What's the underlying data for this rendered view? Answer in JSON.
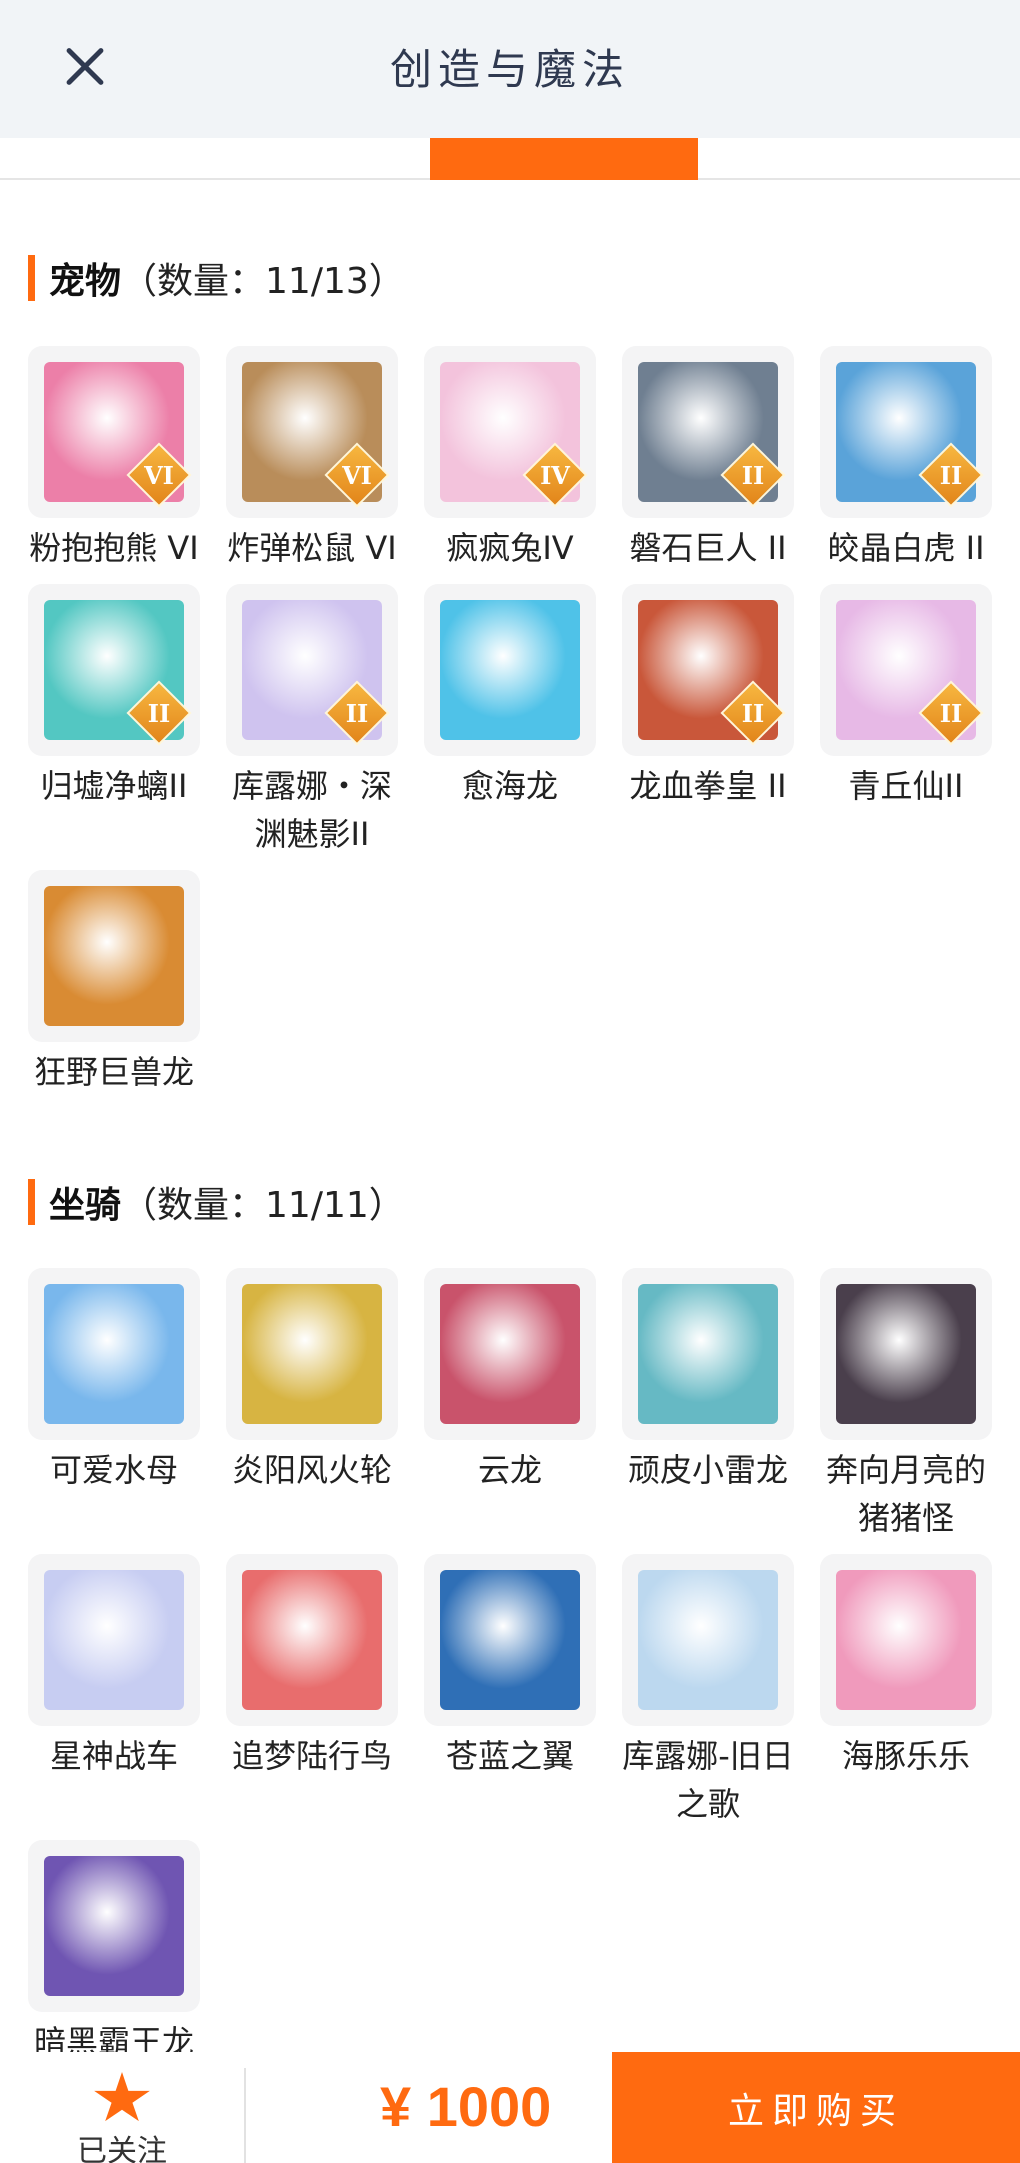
{
  "header": {
    "title": "创造与魔法",
    "close_icon": "close-icon"
  },
  "pets": {
    "title": "宠物",
    "count": "（数量：11/13）",
    "items": [
      {
        "name": "粉抱抱熊 VI",
        "badge": "VI",
        "color": "#ec7fa8"
      },
      {
        "name": "炸弹松鼠 VI",
        "badge": "VI",
        "color": "#b98d5a"
      },
      {
        "name": "疯疯兔IV",
        "badge": "IV",
        "color": "#f3c3dc"
      },
      {
        "name": "磐石巨人 II",
        "badge": "II",
        "color": "#6f7f91"
      },
      {
        "name": "皎晶白虎 II",
        "badge": "II",
        "color": "#5aa3d9"
      },
      {
        "name": "归墟净螭II",
        "badge": "II",
        "color": "#53c7c2"
      },
      {
        "name": "库露娜・深渊魅影II",
        "badge": "II",
        "color": "#cfc3ef"
      },
      {
        "name": "愈海龙",
        "badge": "",
        "color": "#4fc2e8"
      },
      {
        "name": "龙血拳皇 II",
        "badge": "II",
        "color": "#c9573a"
      },
      {
        "name": "青丘仙II",
        "badge": "II",
        "color": "#e7b9e6"
      },
      {
        "name": "狂野巨兽龙",
        "badge": "",
        "color": "#d98b33"
      }
    ]
  },
  "mounts": {
    "title": "坐骑",
    "count": "（数量：11/11）",
    "items": [
      {
        "name": "可爱水母",
        "color": "#79b7ec"
      },
      {
        "name": "炎阳风火轮",
        "color": "#d7b442"
      },
      {
        "name": "云龙",
        "color": "#c9536b"
      },
      {
        "name": "顽皮小雷龙",
        "color": "#66b9c4"
      },
      {
        "name": "奔向月亮的猪猪怪",
        "color": "#4a3f4c"
      },
      {
        "name": "星神战车",
        "color": "#c7cdf2"
      },
      {
        "name": "追梦陆行鸟",
        "color": "#e86d6d"
      },
      {
        "name": "苍蓝之翼",
        "color": "#2f6fb6"
      },
      {
        "name": "库露娜-旧日之歌",
        "color": "#bcd8ef"
      },
      {
        "name": "海豚乐乐",
        "color": "#f09abc"
      },
      {
        "name": "暗黑霸王龙",
        "color": "#6f55b2"
      }
    ]
  },
  "footer": {
    "follow_label": "已关注",
    "star_icon": "star-icon",
    "price": "¥ 1000",
    "buy_label": "立即购买"
  }
}
